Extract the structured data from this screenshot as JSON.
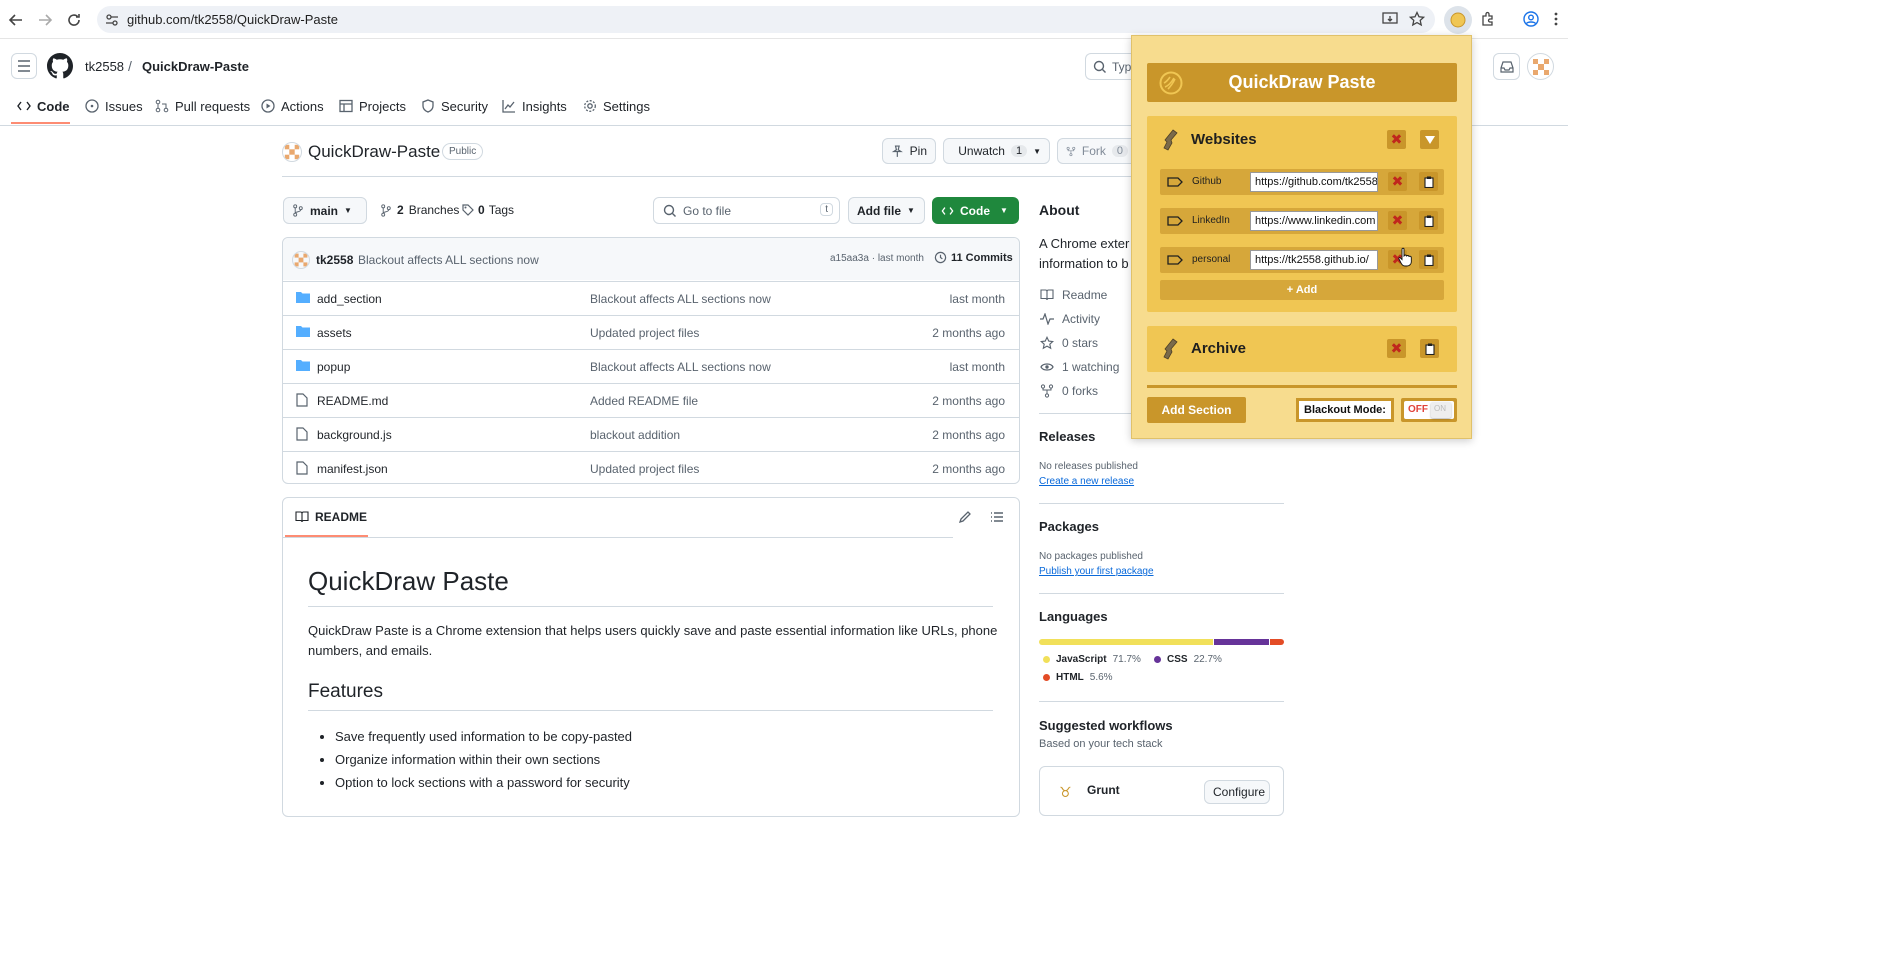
{
  "browser": {
    "url": "github.com/tk2558/QuickDraw-Paste"
  },
  "header": {
    "owner": "tk2558",
    "separator": "/",
    "repo": "QuickDraw-Paste",
    "search_placeholder": "Type"
  },
  "repo_tabs": [
    {
      "label": "Code"
    },
    {
      "label": "Issues"
    },
    {
      "label": "Pull requests"
    },
    {
      "label": "Actions"
    },
    {
      "label": "Projects"
    },
    {
      "label": "Security"
    },
    {
      "label": "Insights"
    },
    {
      "label": "Settings"
    }
  ],
  "repo": {
    "name": "QuickDraw-Paste",
    "visibility": "Public",
    "pin_label": "Pin",
    "unwatch_label": "Unwatch",
    "watch_count": "1",
    "fork_label": "Fork",
    "fork_count": "0"
  },
  "toolbar": {
    "branch": "main",
    "branches_count": "2",
    "branches_label": "Branches",
    "tags_count": "0",
    "tags_label": "Tags",
    "goto_placeholder": "Go to file",
    "goto_key": "t",
    "add_file_label": "Add file",
    "code_label": "Code"
  },
  "commit": {
    "author": "tk2558",
    "message": "Blackout affects ALL sections now",
    "hash_time": "a15aa3a · last month",
    "commits_label": "11 Commits"
  },
  "files": [
    {
      "name": "add_section",
      "type": "folder",
      "message": "Blackout affects ALL sections now",
      "date": "last month"
    },
    {
      "name": "assets",
      "type": "folder",
      "message": "Updated project files",
      "date": "2 months ago"
    },
    {
      "name": "popup",
      "type": "folder",
      "message": "Blackout affects ALL sections now",
      "date": "last month"
    },
    {
      "name": "README.md",
      "type": "file",
      "message": "Added README file",
      "date": "2 months ago"
    },
    {
      "name": "background.js",
      "type": "file",
      "message": "blackout addition",
      "date": "2 months ago"
    },
    {
      "name": "manifest.json",
      "type": "file",
      "message": "Updated project files",
      "date": "2 months ago"
    }
  ],
  "readme": {
    "tab_label": "README",
    "h1": "QuickDraw Paste",
    "intro": "QuickDraw Paste is a Chrome extension that helps users quickly save and paste essential information like URLs, phone numbers, and emails.",
    "features_heading": "Features",
    "features": [
      "Save frequently used information to be copy-pasted",
      "Organize information within their own sections",
      "Option to lock sections with a password for security"
    ]
  },
  "about": {
    "heading": "About",
    "desc_line1": "A Chrome exter",
    "desc_line2": "information to b",
    "readme": "Readme",
    "activity": "Activity",
    "stars": "0 stars",
    "watching": "1 watching",
    "forks": "0 forks"
  },
  "releases": {
    "heading": "Releases",
    "text": "No releases published",
    "link": "Create a new release"
  },
  "packages": {
    "heading": "Packages",
    "text": "No packages published",
    "link": "Publish your first package"
  },
  "languages": {
    "heading": "Languages",
    "items": [
      {
        "name": "JavaScript",
        "pct": "71.7%",
        "value": 71.7,
        "color": "#f1e05a"
      },
      {
        "name": "CSS",
        "pct": "22.7%",
        "value": 22.7,
        "color": "#663399"
      },
      {
        "name": "HTML",
        "pct": "5.6%",
        "value": 5.6,
        "color": "#e34c26"
      }
    ]
  },
  "workflows": {
    "heading": "Suggested workflows",
    "sub": "Based on your tech stack",
    "item_name": "Grunt",
    "configure_label": "Configure"
  },
  "extension": {
    "title": "QuickDraw Paste",
    "sections": [
      {
        "name": "Websites",
        "entries": [
          {
            "label": "Github",
            "value": "https://github.com/tk2558"
          },
          {
            "label": "LinkedIn",
            "value": "https://www.linkedin.com"
          },
          {
            "label": "personal",
            "value": "https://tk2558.github.io/"
          }
        ],
        "add_label": "+ Add"
      },
      {
        "name": "Archive",
        "entries": []
      }
    ],
    "add_section_label": "Add Section",
    "blackout_label": "Blackout Mode:",
    "toggle_off": "OFF",
    "toggle_on": "ON",
    "colors": {
      "panel": "#f7dc8e",
      "title_bar": "#c9962a",
      "section": "#f0c653",
      "row": "#d6a73a"
    }
  }
}
